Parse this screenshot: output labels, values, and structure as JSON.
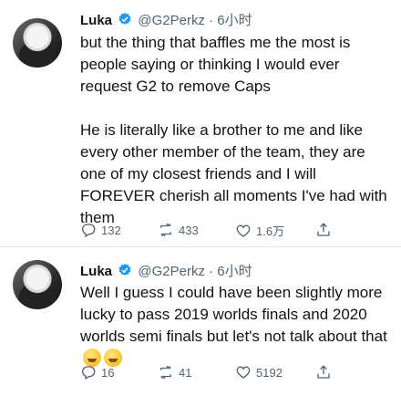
{
  "tweets": [
    {
      "name": "Luka",
      "handle": "@G2Perkz",
      "sep": "·",
      "time": "6小时",
      "text": "but the thing that baffles me the most is people saying or thinking I would ever request G2 to remove Caps\n\nHe is literally like a brother to me and like every other member of the team, they are one of my closest friends and I will FOREVER cherish all moments I've had with them",
      "replies": "132",
      "retweets": "433",
      "likes": "1.6万"
    },
    {
      "name": "Luka",
      "handle": "@G2Perkz",
      "sep": "·",
      "time": "6小时",
      "text": "Well I guess I could have been slightly more lucky to pass 2019 worlds finals and 2020 worlds semi finals but let's not talk about that",
      "emojis": [
        "rolling-on-floor-laughing-emoji",
        "rolling-on-floor-laughing-emoji"
      ],
      "replies": "16",
      "retweets": "41",
      "likes": "5192"
    }
  ],
  "colors": {
    "verified": "#1d9bf0",
    "muted": "#536471",
    "text": "#0f1419",
    "divider": "#e1e8ed"
  },
  "icons": {
    "reply": "speech-bubble-icon",
    "retweet": "retweet-arrows-icon",
    "like": "heart-outline-icon",
    "share": "share-upload-icon",
    "verified": "verified-badge-icon"
  }
}
